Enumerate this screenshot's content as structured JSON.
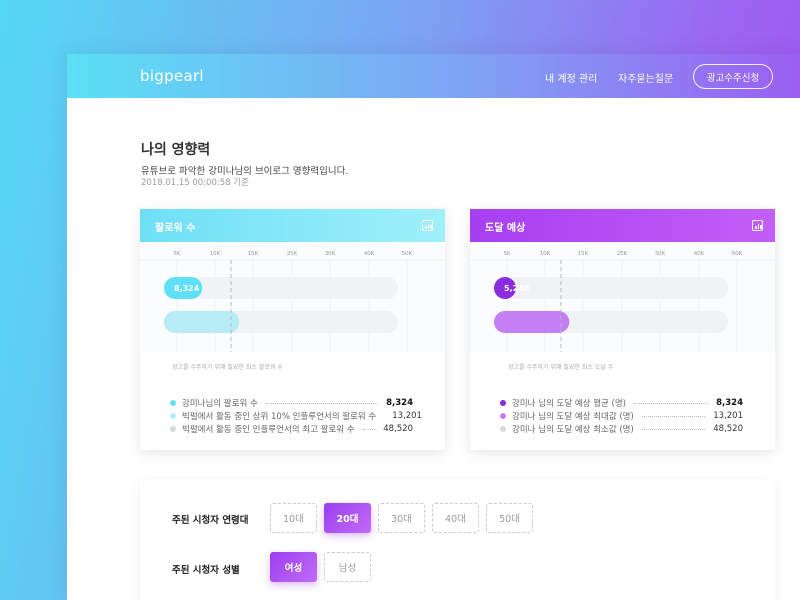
{
  "header": {
    "logo": "bigpearl",
    "nav": [
      "내 계정 관리",
      "자주묻는질문"
    ],
    "cta": "광고수주신청"
  },
  "page": {
    "title": "나의 영향력",
    "subtitle": "유튜브로 파악한 강미나님의 브이로그 영향력입니다.",
    "timestamp": "2018.01.15 00:00:58 기준"
  },
  "colors": {
    "cyan": "#5ee0f6",
    "cyan_light": "#b7ecf7",
    "purple": "#8a2be2",
    "purple_light": "#c47ff5"
  },
  "cards": [
    {
      "title": "팔로워 수",
      "icon": "bar-chart-icon",
      "note": "광고를 수주하기 위해 필요한 최소 팔로워 수",
      "chart_data": {
        "type": "bar",
        "ticks": [
          "5K",
          "10K",
          "15K",
          "25K",
          "30K",
          "40K",
          "50K"
        ],
        "bars": [
          {
            "label": "8,324",
            "value": 8324
          },
          {
            "value": 13201
          }
        ],
        "max": 48520,
        "threshold": 10000
      },
      "legend": [
        {
          "label": "강미나님의 팔로워 수",
          "value": "8,324",
          "color": "#5ee0f6",
          "strong": true
        },
        {
          "label": "빅펄에서 활동 중인 상위 10% 인플루언서의 팔로워 수",
          "value": "13,201",
          "color": "#b7ecf7"
        },
        {
          "label": "빅펄에서 활동 중인 인플루언서의 최고 팔로워 수",
          "value": "48,520",
          "color": "#d9d9d9"
        }
      ]
    },
    {
      "title": "도달 예상",
      "icon": "bar-chart-icon",
      "note": "광고를 수주하기 위해 필요한 최소 도달 수",
      "chart_data": {
        "type": "bar",
        "ticks": [
          "5K",
          "10K",
          "15K",
          "25K",
          "30K",
          "40K",
          "50K"
        ],
        "bars": [
          {
            "label": "5,240",
            "value": 5240
          },
          {
            "value": 13201
          }
        ],
        "max": 48520,
        "threshold": 10000
      },
      "legend": [
        {
          "label": "강미나 님의 도달 예상 평균 (명)",
          "value": "8,324",
          "color": "#8a2be2",
          "strong": true
        },
        {
          "label": "강미나 님의 도달 예상 최대값 (명)",
          "value": "13,201",
          "color": "#c47ff5"
        },
        {
          "label": "강미나 님의 도달 예상 최소값 (명)",
          "value": "48,520",
          "color": "#d9d9d9"
        }
      ]
    }
  ],
  "filters": {
    "age_label": "주된 시청자 연령대",
    "ages": [
      "10대",
      "20대",
      "30대",
      "40대",
      "50대"
    ],
    "age_selected": "20대",
    "gender_label": "주된 시청자 성별",
    "genders": [
      "여성",
      "남성"
    ],
    "gender_selected": "여성"
  }
}
